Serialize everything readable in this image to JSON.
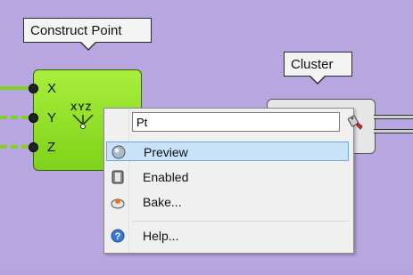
{
  "tooltips": {
    "component": "Construct Point",
    "cluster": "Cluster"
  },
  "component": {
    "inputs": [
      "X",
      "Y",
      "Z"
    ],
    "icon_label": "XYZ"
  },
  "context_menu": {
    "name_value": "Pt",
    "items": [
      {
        "label": "Preview",
        "icon": "preview-icon",
        "highlighted": true
      },
      {
        "label": "Enabled",
        "icon": "enabled-icon"
      },
      {
        "label": "Bake...",
        "icon": "bake-icon"
      },
      {
        "label": "Help...",
        "icon": "help-icon"
      }
    ]
  },
  "colors": {
    "canvas": "#b8a6e1",
    "component_fill": "#8fdb24",
    "highlight": "#c8e2f8"
  }
}
